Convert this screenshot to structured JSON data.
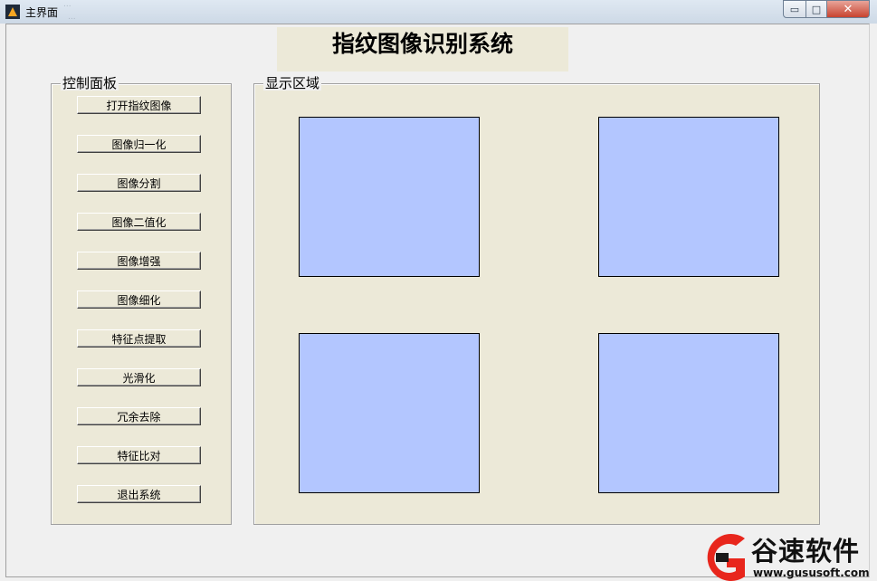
{
  "window": {
    "title": "主界面",
    "ghost_texts": [
      "...",
      "..."
    ],
    "buttons": {
      "minimize": "▭",
      "maximize": "□",
      "close": "✕"
    }
  },
  "header": {
    "title": "指纹图像识别系统"
  },
  "control_panel": {
    "label": "控制面板",
    "buttons": [
      "打开指纹图像",
      "图像归一化",
      "图像分割",
      "图像二值化",
      "图像增强",
      "图像细化",
      "特征点提取",
      "光滑化",
      "冗余去除",
      "特征比对",
      "退出系统"
    ]
  },
  "display_panel": {
    "label": "显示区域"
  },
  "colors": {
    "axes_fill": "#b3c6ff",
    "panel_bg": "#ece9d8",
    "window_bg": "#f0f0f0"
  },
  "watermark": {
    "text": "谷速软件",
    "url": "www.gususoft.com",
    "logo_colors": [
      "#e8261c",
      "#1a1a1a"
    ]
  }
}
